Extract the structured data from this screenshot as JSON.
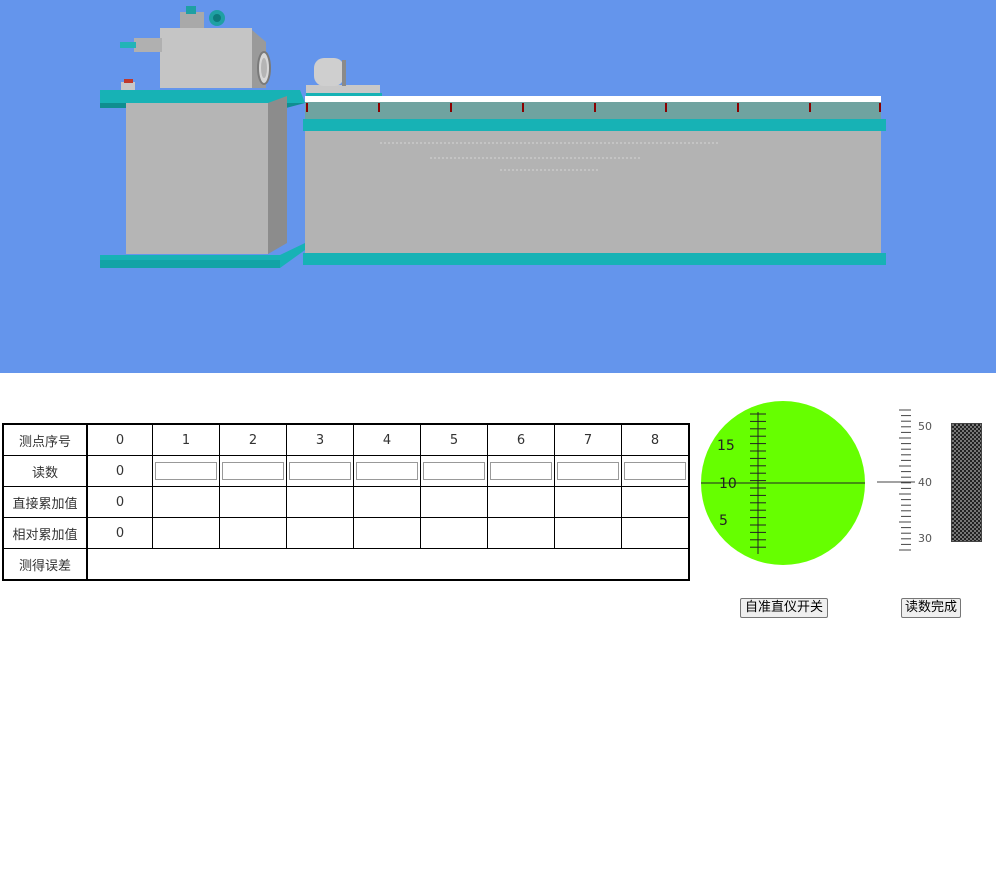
{
  "table": {
    "row_headers": [
      "测点序号",
      "读数",
      "直接累加值",
      "相对累加值",
      "测得误差"
    ],
    "point_indices": [
      "0",
      "1",
      "2",
      "3",
      "4",
      "5",
      "6",
      "7",
      "8"
    ],
    "reading_first": "0",
    "direct_sum_first": "0",
    "relative_sum_first": "0"
  },
  "scope": {
    "labels": [
      "15",
      "10",
      "5"
    ],
    "color": "#66ff00"
  },
  "scale": {
    "labels": [
      "50",
      "40",
      "30"
    ]
  },
  "buttons": {
    "autocollimator_switch": "自准直仪开关",
    "reading_done": "读数完成"
  },
  "scene": {
    "background": "#6495ec",
    "accent": "#17b2b5",
    "body": "#b3b3b3"
  }
}
